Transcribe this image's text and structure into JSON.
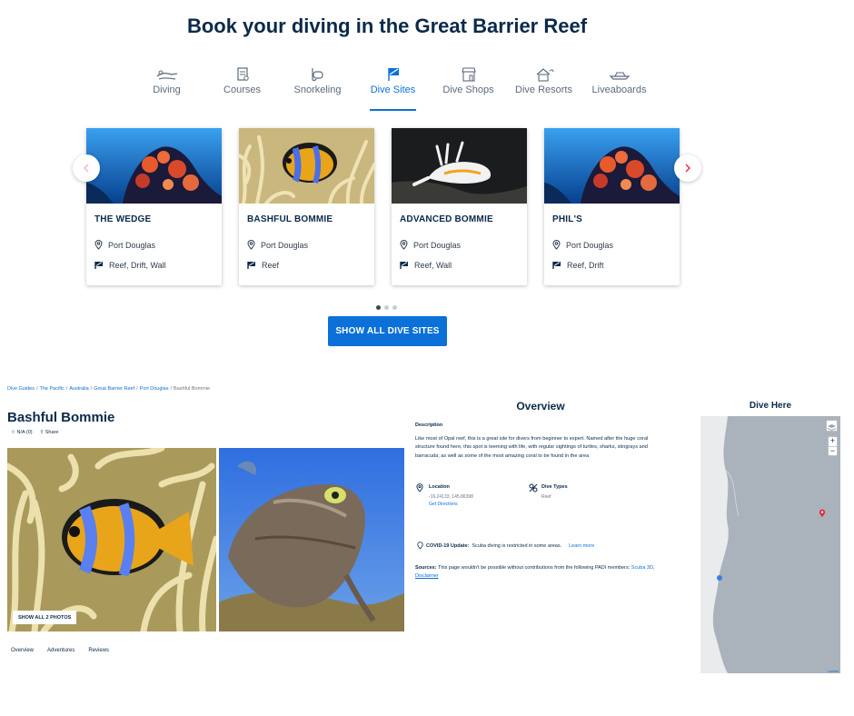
{
  "hero": {
    "title": "Book your diving in the Great Barrier Reef"
  },
  "categories": [
    {
      "label": "Diving",
      "icon": "diver-icon",
      "active": false
    },
    {
      "label": "Courses",
      "icon": "certificate-icon",
      "active": false
    },
    {
      "label": "Snorkeling",
      "icon": "snorkel-mask-icon",
      "active": false
    },
    {
      "label": "Dive Sites",
      "icon": "dive-flag-icon",
      "active": true
    },
    {
      "label": "Dive Shops",
      "icon": "shop-icon",
      "active": false
    },
    {
      "label": "Dive Resorts",
      "icon": "resort-icon",
      "active": false
    },
    {
      "label": "Liveaboards",
      "icon": "boat-icon",
      "active": false
    }
  ],
  "cards": [
    {
      "name": "THE WEDGE",
      "location": "Port Douglas",
      "types": "Reef, Drift, Wall",
      "image": "coral-reef"
    },
    {
      "name": "BASHFUL BOMMIE",
      "location": "Port Douglas",
      "types": "Reef",
      "image": "clownfish"
    },
    {
      "name": "ADVANCED BOMMIE",
      "location": "Port Douglas",
      "types": "Reef, Wall",
      "image": "nudibranch"
    },
    {
      "name": "PHIL'S",
      "location": "Port Douglas",
      "types": "Reef, Drift",
      "image": "coral-reef"
    }
  ],
  "carousel": {
    "pages": 3,
    "current_page": 1
  },
  "show_all_button": "SHOW ALL DIVE SITES",
  "breadcrumb": [
    "Dive Guides",
    "The Pacific",
    "Australia",
    "Great Barrier Reef",
    "Port Douglas",
    "Bashful Bommie"
  ],
  "site": {
    "title": "Bashful Bommie",
    "rating": "N/A (0)",
    "share": "Share",
    "show_photos": "SHOW ALL 2 PHOTOS",
    "tabs": [
      "Overview",
      "Adventures",
      "Reviews"
    ]
  },
  "overview": {
    "heading": "Overview",
    "description_label": "Description",
    "description": "Like most of Opal reef, this is a great site for divers from beginner to expert. Named after the huge coral structure found here, this spot is teeming with life, with regular sightings of turtles, sharks, stingrays and barracuda; as well as some of the most amazing coral to be found in the area",
    "location_label": "Location",
    "location_value": "-16.24133, 145.86398",
    "directions": "Get Directions",
    "dive_types_label": "Dive Types",
    "dive_types_value": "Reef",
    "covid_label": "COVID-19 Update:",
    "covid_text": "Scuba diving is restricted in some areas.",
    "learn_more": "Learn more",
    "sources_label": "Sources:",
    "sources_text": "This page wouldn't be possible without contributions from the following PADI members:",
    "sources_link1": "Scuba 3D",
    "sources_comma": ",",
    "sources_link2": "Disclaimer"
  },
  "map": {
    "heading": "Dive Here",
    "zoom_in": "+",
    "zoom_out": "−",
    "attribution": "Leaflet"
  },
  "colors": {
    "accent": "#0b70d8",
    "heading": "#0b2a4a",
    "pin": "#e8283c"
  }
}
